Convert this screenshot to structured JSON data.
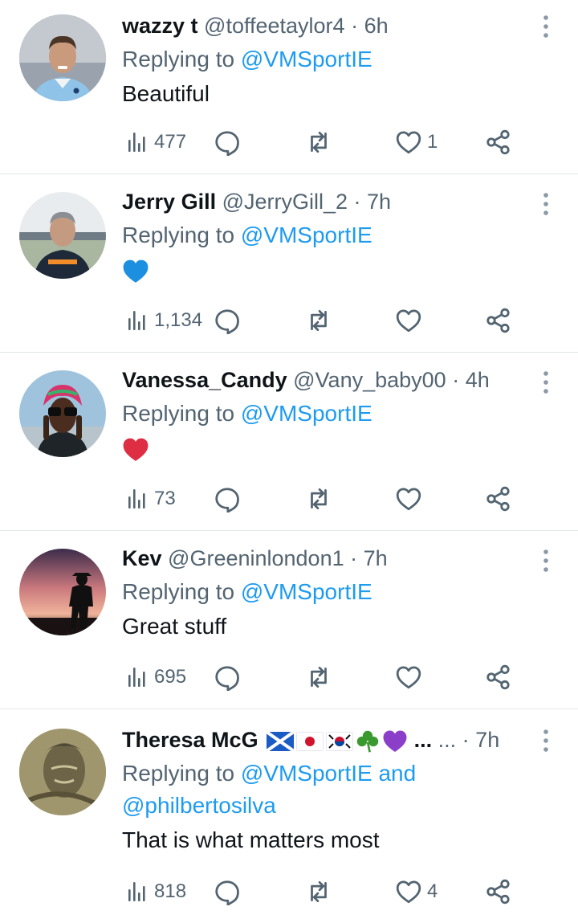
{
  "tweets": [
    {
      "name": "wazzy t",
      "handle": "@toffeetaylor4",
      "time": "6h",
      "replying_prefix": "Replying to ",
      "replying_to": "@VMSportIE",
      "text": "Beautiful",
      "views": "477",
      "likes": "1"
    },
    {
      "name": "Jerry Gill",
      "handle": "@JerryGill_2",
      "time": "7h",
      "replying_prefix": "Replying to ",
      "replying_to": "@VMSportIE",
      "emoji": "blue-heart",
      "views": "1,134",
      "likes": ""
    },
    {
      "name": "Vanessa_Candy",
      "handle": "@Vany_baby00",
      "time": "4h",
      "replying_prefix": "Replying to ",
      "replying_to": "@VMSportIE",
      "emoji": "red-heart",
      "views": "73",
      "likes": ""
    },
    {
      "name": "Kev",
      "handle": "@Greeninlondon1",
      "time": "7h",
      "replying_prefix": "Replying to ",
      "replying_to": "@VMSportIE",
      "text": "Great stuff",
      "views": "695",
      "likes": ""
    },
    {
      "name": "Theresa McG",
      "name_suffix": "...",
      "handle": "...",
      "time": "7h",
      "replying_prefix": "Replying to ",
      "replying_to": "@VMSportIE and",
      "replying_to_2": "@philbertosilva",
      "text": "That is what matters most",
      "views": "818",
      "likes": "4"
    }
  ],
  "separator": " · ",
  "colors": {
    "link": "#1d9bf0",
    "secondary": "#536471",
    "text": "#0f1419",
    "divider": "#e1e5e8"
  }
}
